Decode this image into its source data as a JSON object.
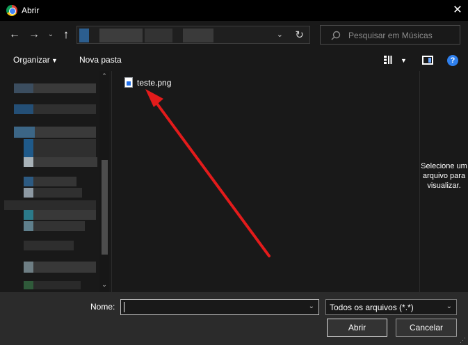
{
  "window": {
    "title": "Abrir",
    "close_glyph": "✕"
  },
  "nav": {
    "back_glyph": "←",
    "forward_glyph": "→",
    "recent_glyph": "⌄",
    "up_glyph": "↑",
    "address_dropdown_glyph": "⌄",
    "refresh_glyph": "↻",
    "search_placeholder": "Pesquisar em Músicas"
  },
  "toolbar": {
    "organize_label": "Organizar",
    "organize_caret": "▼",
    "new_folder_label": "Nova pasta",
    "view_caret": "▼",
    "help_glyph": "?"
  },
  "navpane": {
    "scroll_up_glyph": "⌃",
    "scroll_down_glyph": "⌄"
  },
  "files": [
    {
      "name": "teste.png",
      "icon": "image-file-icon"
    }
  ],
  "annotation": {
    "arrow_color": "#e31b1b"
  },
  "preview": {
    "message": "Selecione um arquivo para visualizar."
  },
  "bottom": {
    "name_label": "Nome:",
    "name_value": "",
    "name_dropdown_glyph": "⌄",
    "file_type": "Todos os arquivos (*.*)",
    "file_type_dropdown_glyph": "⌄",
    "open_button": "Abrir",
    "cancel_button": "Cancelar",
    "grip_glyph": "⋰"
  }
}
